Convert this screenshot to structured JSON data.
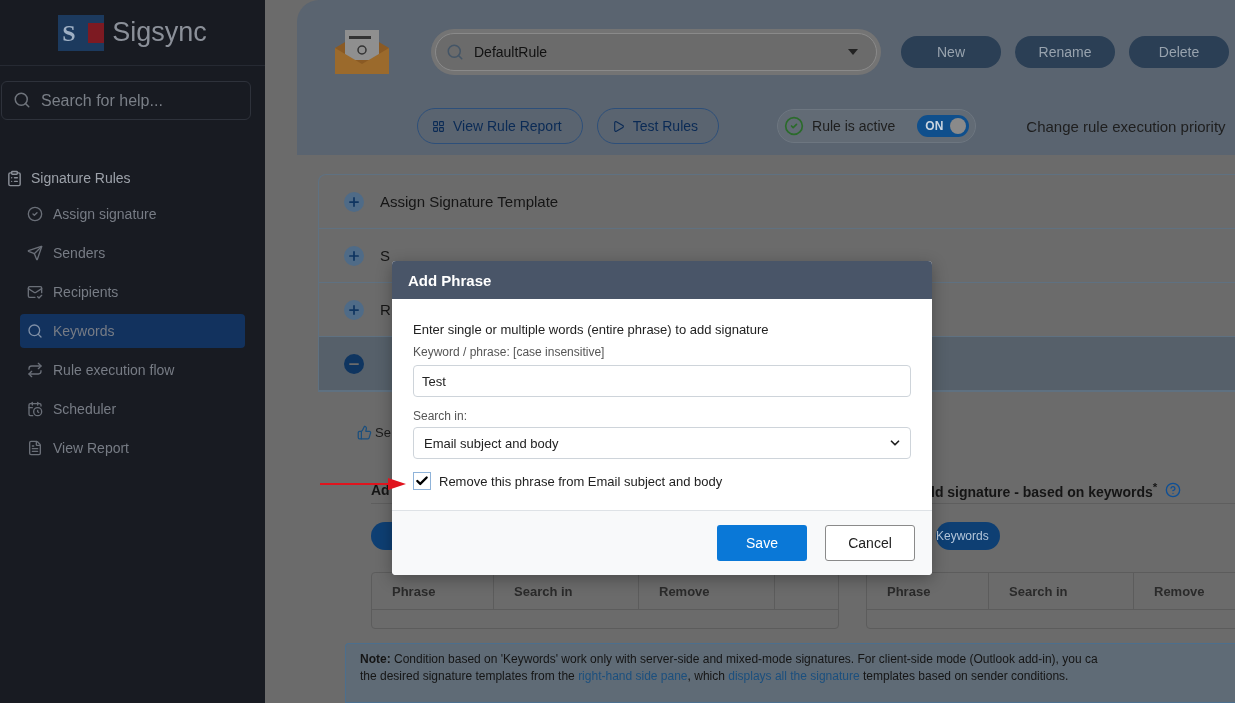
{
  "sidebar": {
    "logo_mark": "S",
    "logo": "Sigsync",
    "search": {
      "placeholder": "Search for help..."
    },
    "section": "Signature Rules",
    "items": [
      {
        "label": "Assign signature",
        "selected": false
      },
      {
        "label": "Senders",
        "selected": false
      },
      {
        "label": "Recipients",
        "selected": false
      },
      {
        "label": "Keywords",
        "selected": true
      },
      {
        "label": "Rule execution flow",
        "selected": false
      },
      {
        "label": "Scheduler",
        "selected": false
      },
      {
        "label": "View Report",
        "selected": false
      }
    ]
  },
  "header": {
    "rule_select": {
      "value": "DefaultRule"
    },
    "buttons": [
      "New",
      "Rename",
      "Delete"
    ],
    "actions": [
      "View Rule Report",
      "Test Rules"
    ],
    "rule_active": {
      "label": "Rule is active",
      "on": true,
      "toggle_text": "ON"
    },
    "priority_label": "Change rule execution priority"
  },
  "accordion": [
    {
      "title": "Assign Signature Template",
      "expanded": false
    },
    {
      "title": "S",
      "expanded": false
    },
    {
      "title": "R",
      "expanded": false
    },
    {
      "expanded": true
    }
  ],
  "content": {
    "hint": "Se",
    "left_heading": "Ad",
    "right_heading": "ld signature - based on keywords$^{*}$",
    "right_button": "Keywords",
    "left_table": {
      "columns": [
        "Phrase",
        "Search in",
        "Remove"
      ]
    },
    "right_table": {
      "columns": [
        "Phrase",
        "Search in",
        "Remove"
      ]
    },
    "note": {
      "label": "Note:",
      "lines": [
        [
          {
            "kind": "text",
            "text": "Condition based on 'Keywords' work only with server-side and mixed-mode signatures. For client-side mode (Outlook add-in), you ca"
          }
        ],
        [
          {
            "kind": "text",
            "text": "the desired signature templates from the "
          },
          {
            "kind": "link",
            "text": "right-hand side pane"
          },
          {
            "kind": "text",
            "text": ", which "
          },
          {
            "kind": "link",
            "text": "displays all the signature"
          },
          {
            "kind": "text",
            "text": " templates based on sender conditions."
          }
        ]
      ]
    }
  },
  "dialog": {
    "title": "Add Phrase",
    "intro": "Enter single or multiple words (entire phrase) to add signature",
    "keyword_label": "Keyword / phrase: [case insensitive]",
    "keyword_value": "Test",
    "search_label": "Search in:",
    "search_value": "Email subject and body",
    "remove": {
      "label": "Remove this phrase from Email subject and body",
      "checked": true
    },
    "save": "Save",
    "cancel": "Cancel"
  }
}
